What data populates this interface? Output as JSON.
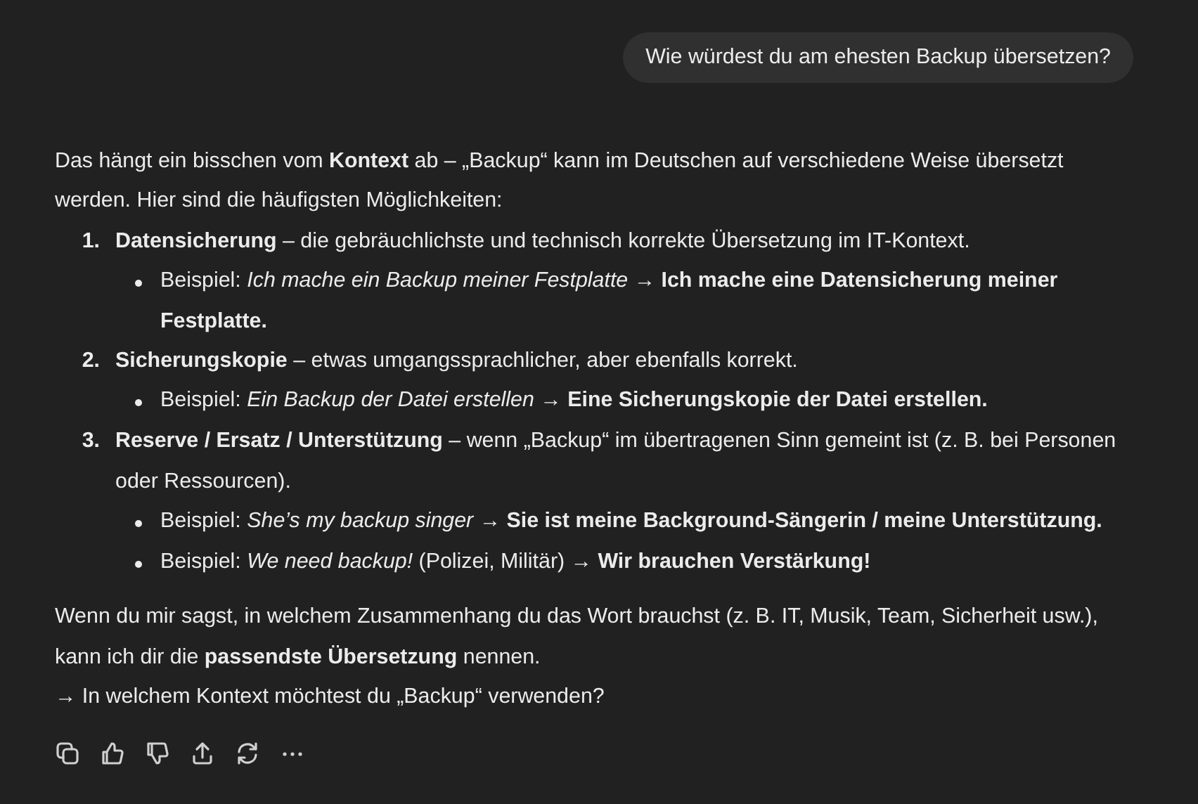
{
  "user_message": {
    "text": "Wie würdest du am ehesten Backup übersetzen?"
  },
  "answer": {
    "intro": "Das hängt ein bisschen vom **Kontext** ab – „Backup“ kann im Deutschen auf verschiedene Weise übersetzt werden. Hier sind die häufigsten Möglichkeiten:",
    "items": [
      {
        "number": "1.",
        "text": "**Datensicherung** – die gebräuchlichste und technisch korrekte Übersetzung im IT-Kontext.",
        "examples": [
          "Beispiel: *Ich mache ein Backup meiner Festplatte* → **Ich mache eine Datensicherung meiner Festplatte.**"
        ]
      },
      {
        "number": "2.",
        "text": "**Sicherungskopie** – etwas umgangssprachlicher, aber ebenfalls korrekt.",
        "examples": [
          "Beispiel: *Ein Backup der Datei erstellen* → **Eine Sicherungskopie der Datei erstellen.**"
        ]
      },
      {
        "number": "3.",
        "text": "**Reserve / Ersatz / Unterstützung** – wenn „Backup“ im übertragenen Sinn gemeint ist (z. B. bei Personen oder Ressourcen).",
        "examples": [
          "Beispiel: *She’s my backup singer* → **Sie ist meine Background-Sängerin / meine Unterstützung.**",
          "Beispiel: *We need backup!* (Polizei, Militär) → **Wir brauchen Verstärkung!**"
        ]
      }
    ],
    "closing": "Wenn du mir sagst, in welchem Zusammenhang du das Wort brauchst (z. B. IT, Musik, Team, Sicherheit usw.), kann ich dir die **passendste Übersetzung** nennen.",
    "follow_up": "→ In welchem Kontext möchtest du „Backup“ verwenden?"
  }
}
